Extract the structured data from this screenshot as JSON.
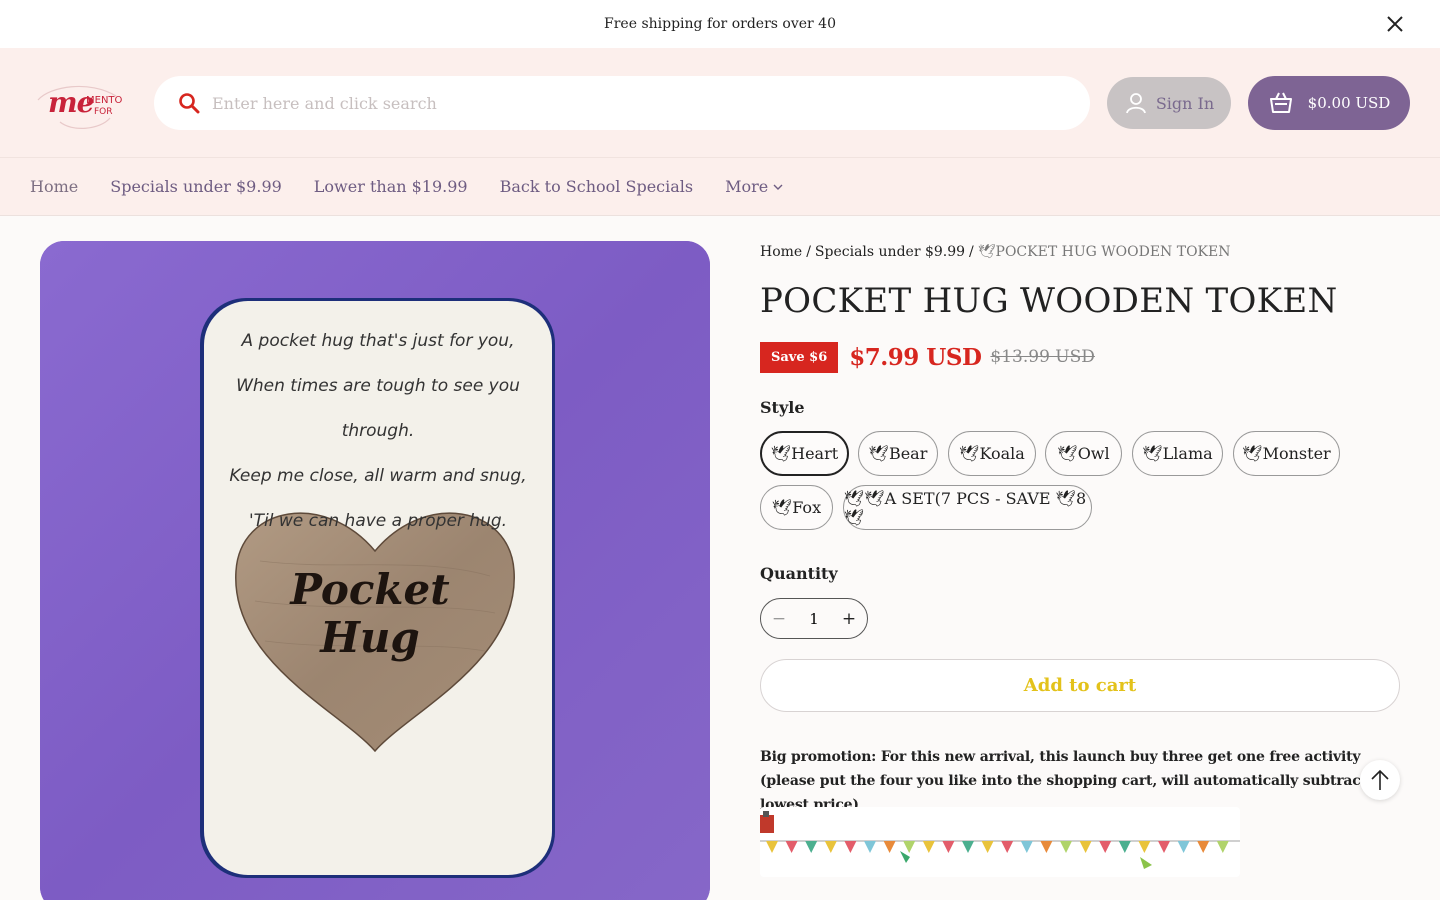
{
  "announcement": {
    "text": "Free shipping for orders over 40"
  },
  "header": {
    "logo_text_main": "me",
    "logo_text_top": "MENTO",
    "logo_text_bottom": "FOR",
    "search_placeholder": "Enter here and click search",
    "signin_label": "Sign In",
    "cart_label": "$0.00 USD"
  },
  "nav": {
    "items": [
      {
        "label": "Home"
      },
      {
        "label": "Specials under $9.99"
      },
      {
        "label": "Lower than $19.99"
      },
      {
        "label": "Back to School Specials"
      },
      {
        "label": "More"
      }
    ]
  },
  "product_image": {
    "card_lines": [
      "A pocket hug that's just for you,",
      "When times are tough to see you through.",
      "Keep me close, all warm and snug,",
      "'Til we can have a proper hug."
    ],
    "token_line1": "Pocket",
    "token_line2": "Hug"
  },
  "product": {
    "breadcrumb": {
      "home": "Home",
      "sep1": "/",
      "category": "Specials under $9.99",
      "sep2": "/",
      "current": "🕊POCKET HUG WOODEN TOKEN"
    },
    "title": "POCKET HUG WOODEN TOKEN",
    "save_badge": "Save $6",
    "price": "$7.99 USD",
    "compare_price": "$13.99 USD",
    "style_label": "Style",
    "options": [
      {
        "label": "🕊Heart",
        "selected": true
      },
      {
        "label": "🕊Bear",
        "selected": false
      },
      {
        "label": "🕊Koala",
        "selected": false
      },
      {
        "label": "🕊Owl",
        "selected": false
      },
      {
        "label": "🕊Llama",
        "selected": false
      },
      {
        "label": "🕊Monster",
        "selected": false
      },
      {
        "label": "🕊Fox",
        "selected": false
      },
      {
        "label": "🕊🕊A SET(7 PCS - SAVE 🕊8🕊",
        "selected": false
      }
    ],
    "quantity_label": "Quantity",
    "quantity_value": "1",
    "minus_label": "−",
    "plus_label": "+",
    "add_to_cart": "Add to cart",
    "promo_text": "Big promotion: For this new arrival, this launch buy three get one free activity (please put the four you like into the shopping cart, will automatically subtract the lowest price)"
  },
  "colors": {
    "accent_purple": "#7e6494",
    "sale_red": "#d7261f",
    "add_to_cart_text": "#e3c21a",
    "header_bg": "#fcefec"
  },
  "icons": {
    "close": "close-icon",
    "search": "search-icon",
    "user": "user-icon",
    "cart": "basket-icon",
    "back_to_top": "arrow-up-icon"
  }
}
